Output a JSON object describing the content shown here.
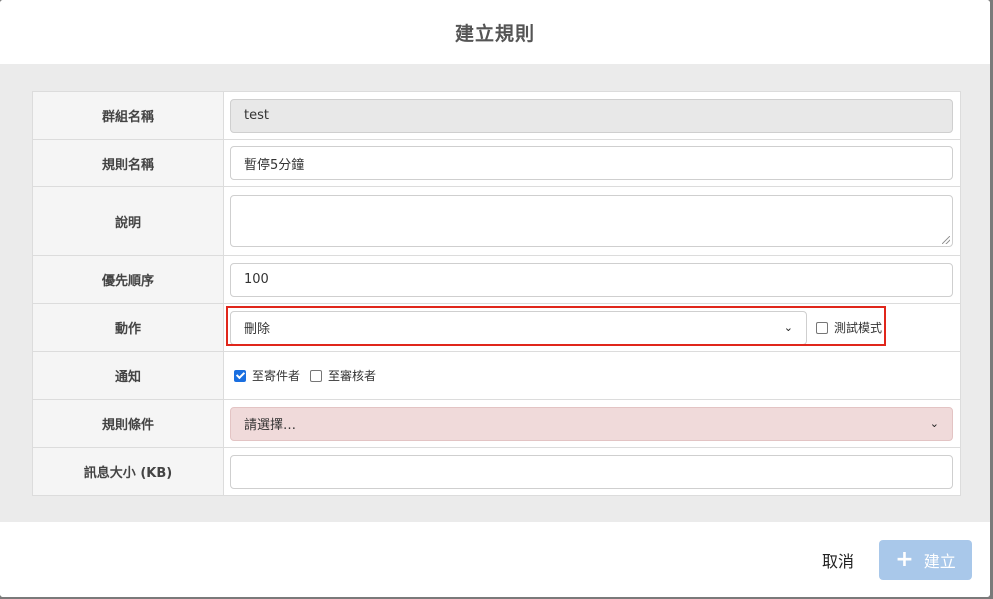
{
  "modal": {
    "title": "建立規則"
  },
  "form": {
    "group_name": {
      "label": "群組名稱",
      "value": "test"
    },
    "rule_name": {
      "label": "規則名稱",
      "value": "暫停5分鐘"
    },
    "description": {
      "label": "說明",
      "value": ""
    },
    "priority": {
      "label": "優先順序",
      "value": "100"
    },
    "action": {
      "label": "動作",
      "selected": "刪除",
      "test_mode_label": "測試模式",
      "test_mode_checked": false
    },
    "notify": {
      "label": "通知",
      "to_sender_label": "至寄件者",
      "to_sender_checked": true,
      "to_reviewer_label": "至審核者",
      "to_reviewer_checked": false
    },
    "rule_condition": {
      "label": "規則條件",
      "selected": "請選擇…"
    },
    "message_size": {
      "label": "訊息大小 (KB)",
      "value": ""
    }
  },
  "footer": {
    "cancel_label": "取消",
    "create_label": "建立"
  },
  "colors": {
    "highlight": "#e0261b",
    "primary_disabled": "#a9c8ea",
    "invalid_bg": "#f0dada",
    "checkbox_checked": "#1a6fe0"
  },
  "icons": [
    "chevron-down-icon",
    "plus-icon",
    "checkbox-icon"
  ]
}
